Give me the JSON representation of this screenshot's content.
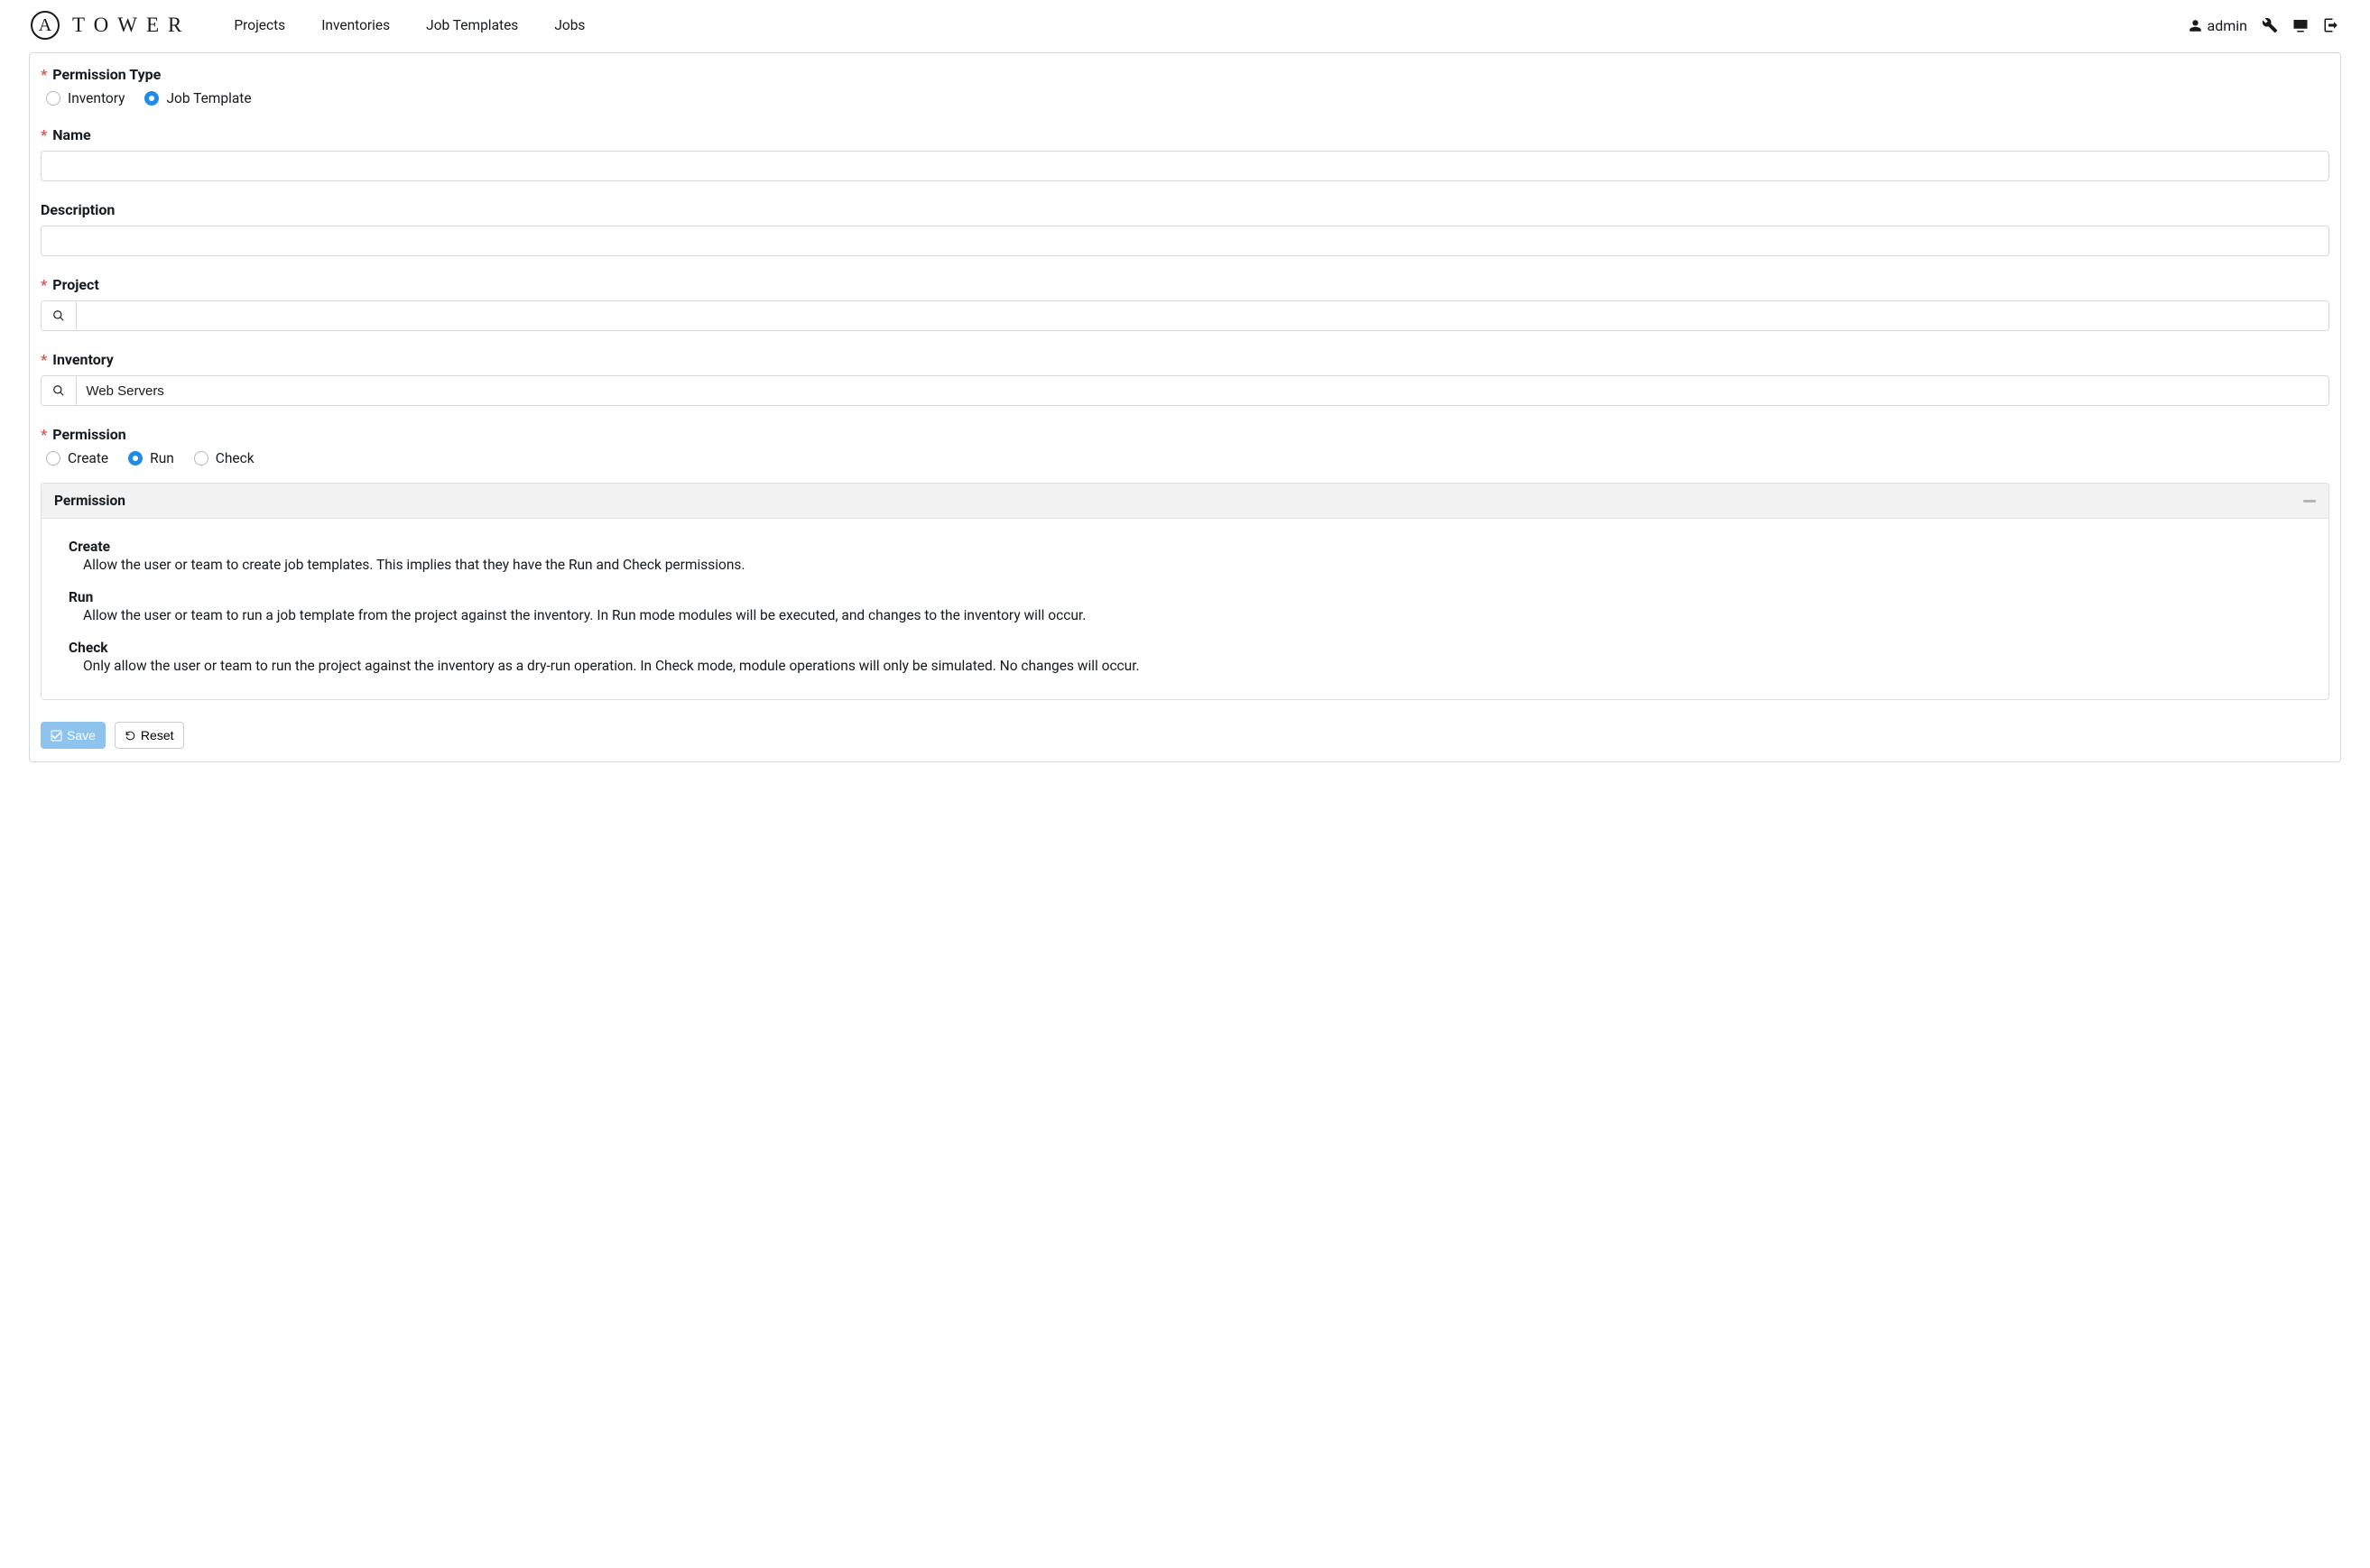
{
  "brand": {
    "mark": "A",
    "name": "TOWER"
  },
  "nav": {
    "projects": "Projects",
    "inventories": "Inventories",
    "jobTemplates": "Job Templates",
    "jobs": "Jobs"
  },
  "user": {
    "name": "admin"
  },
  "form": {
    "permissionType": {
      "label": "Permission Type",
      "options": {
        "inventory": "Inventory",
        "jobTemplate": "Job Template"
      },
      "selected": "jobTemplate"
    },
    "name": {
      "label": "Name",
      "value": ""
    },
    "description": {
      "label": "Description",
      "value": ""
    },
    "project": {
      "label": "Project",
      "value": ""
    },
    "inventory": {
      "label": "Inventory",
      "value": "Web Servers"
    },
    "permission": {
      "label": "Permission",
      "options": {
        "create": "Create",
        "run": "Run",
        "check": "Check"
      },
      "selected": "run"
    }
  },
  "help": {
    "title": "Permission",
    "create": {
      "title": "Create",
      "body": "Allow the user or team to create job templates. This implies that they have the Run and Check permissions."
    },
    "run": {
      "title": "Run",
      "body": "Allow the user or team to run a job template from the project against the inventory. In Run mode modules will be executed, and changes to the inventory will occur."
    },
    "check": {
      "title": "Check",
      "body": "Only allow the user or team to run the project against the inventory as a dry-run operation. In Check mode, module operations will only be simulated. No changes will occur."
    }
  },
  "actions": {
    "save": "Save",
    "reset": "Reset"
  }
}
